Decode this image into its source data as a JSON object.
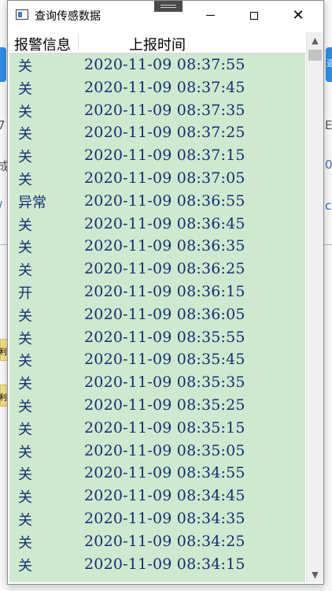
{
  "window": {
    "title": "查询传感数据"
  },
  "background": {
    "left_fragments": [
      "7",
      "成",
      "/"
    ],
    "right_fragments": [
      "E",
      "0",
      "c"
    ],
    "tag_left": "利",
    "button_right": "迴"
  },
  "table": {
    "columns": [
      "报警信息",
      "上报时间"
    ],
    "rows": [
      {
        "alarm": "关",
        "time": "2020-11-09 08:37:55"
      },
      {
        "alarm": "关",
        "time": "2020-11-09 08:37:45"
      },
      {
        "alarm": "关",
        "time": "2020-11-09 08:37:35"
      },
      {
        "alarm": "关",
        "time": "2020-11-09 08:37:25"
      },
      {
        "alarm": "关",
        "time": "2020-11-09 08:37:15"
      },
      {
        "alarm": "关",
        "time": "2020-11-09 08:37:05"
      },
      {
        "alarm": "异常",
        "time": "2020-11-09 08:36:55"
      },
      {
        "alarm": "关",
        "time": "2020-11-09 08:36:45"
      },
      {
        "alarm": "关",
        "time": "2020-11-09 08:36:35"
      },
      {
        "alarm": "关",
        "time": "2020-11-09 08:36:25"
      },
      {
        "alarm": "开",
        "time": "2020-11-09 08:36:15"
      },
      {
        "alarm": "关",
        "time": "2020-11-09 08:36:05"
      },
      {
        "alarm": "关",
        "time": "2020-11-09 08:35:55"
      },
      {
        "alarm": "关",
        "time": "2020-11-09 08:35:45"
      },
      {
        "alarm": "关",
        "time": "2020-11-09 08:35:35"
      },
      {
        "alarm": "关",
        "time": "2020-11-09 08:35:25"
      },
      {
        "alarm": "关",
        "time": "2020-11-09 08:35:15"
      },
      {
        "alarm": "关",
        "time": "2020-11-09 08:35:05"
      },
      {
        "alarm": "关",
        "time": "2020-11-09 08:34:55"
      },
      {
        "alarm": "关",
        "time": "2020-11-09 08:34:45"
      },
      {
        "alarm": "关",
        "time": "2020-11-09 08:34:35"
      },
      {
        "alarm": "关",
        "time": "2020-11-09 08:34:25"
      },
      {
        "alarm": "关",
        "time": "2020-11-09 08:34:15"
      }
    ]
  },
  "colors": {
    "row_background": "#cfe8d0",
    "text": "#12306e"
  },
  "icons": {
    "app": "app-window-icon",
    "minimize": "minimize-icon",
    "maximize": "maximize-icon",
    "close": "close-icon",
    "scroll_up": "chevron-up-icon",
    "scroll_down": "chevron-down-icon"
  }
}
